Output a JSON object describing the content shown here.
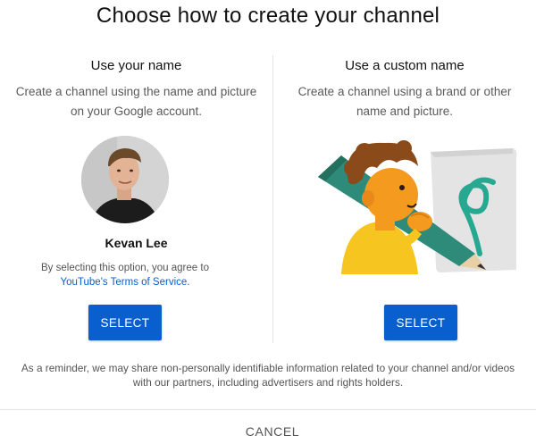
{
  "dialog": {
    "title": "Choose how to create your channel"
  },
  "own_name": {
    "heading": "Use your name",
    "description": "Create a channel using the name and picture\non your Google account.",
    "user_name": "Kevan Lee",
    "agree_text": "By selecting this option, you agree to",
    "tos_link": "YouTube's Terms of Service",
    "tos_suffix": ".",
    "select_label": "SELECT"
  },
  "custom_name": {
    "heading": "Use a custom name",
    "description": "Create a channel using a brand or other\nname and picture.",
    "select_label": "SELECT"
  },
  "reminder": "As a reminder, we may share non-personally identifiable information related to your channel and/or videos with our partners, including advertisers and rights holders.",
  "cancel_label": "CANCEL",
  "colors": {
    "primary_button": "#0a5fce",
    "link": "#065fd4",
    "illustration_teal": "#2e8b7a",
    "illustration_orange": "#f39a1f",
    "illustration_hair": "#8a4a1a",
    "illustration_shirt": "#f7c520"
  }
}
